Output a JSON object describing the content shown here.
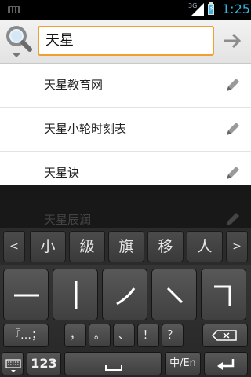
{
  "status_bar": {
    "network": "3G",
    "time": "1:25",
    "icons": [
      "keyboard-notification-icon",
      "signal-icon",
      "battery-charging-icon"
    ]
  },
  "search": {
    "query": "天星",
    "logo_icon": "magnifier-icon",
    "go_icon": "arrow-right-icon"
  },
  "suggestions": [
    {
      "text": "天星教育网",
      "icon": "pencil-icon"
    },
    {
      "text": "天星小轮时刻表",
      "icon": "pencil-icon"
    },
    {
      "text": "天星诀",
      "icon": "pencil-icon"
    },
    {
      "text": "天星辰润",
      "icon": "pencil-icon"
    }
  ],
  "keyboard": {
    "prev_label": "<",
    "next_label": ">",
    "candidates": [
      "小",
      "級",
      "旗",
      "移",
      "人"
    ],
    "strokes": [
      "horizontal",
      "vertical",
      "left-falling",
      "dot",
      "turning"
    ],
    "punct_keys": [
      "『…；",
      "，",
      "。",
      "、",
      "！",
      "？"
    ],
    "bottom": {
      "numbers_label": "123",
      "lang_label": "中/En",
      "keyboard_icon": "keyboard-icon",
      "space_icon": "space-icon",
      "enter_icon": "enter-icon",
      "backspace_icon": "backspace-icon"
    }
  }
}
